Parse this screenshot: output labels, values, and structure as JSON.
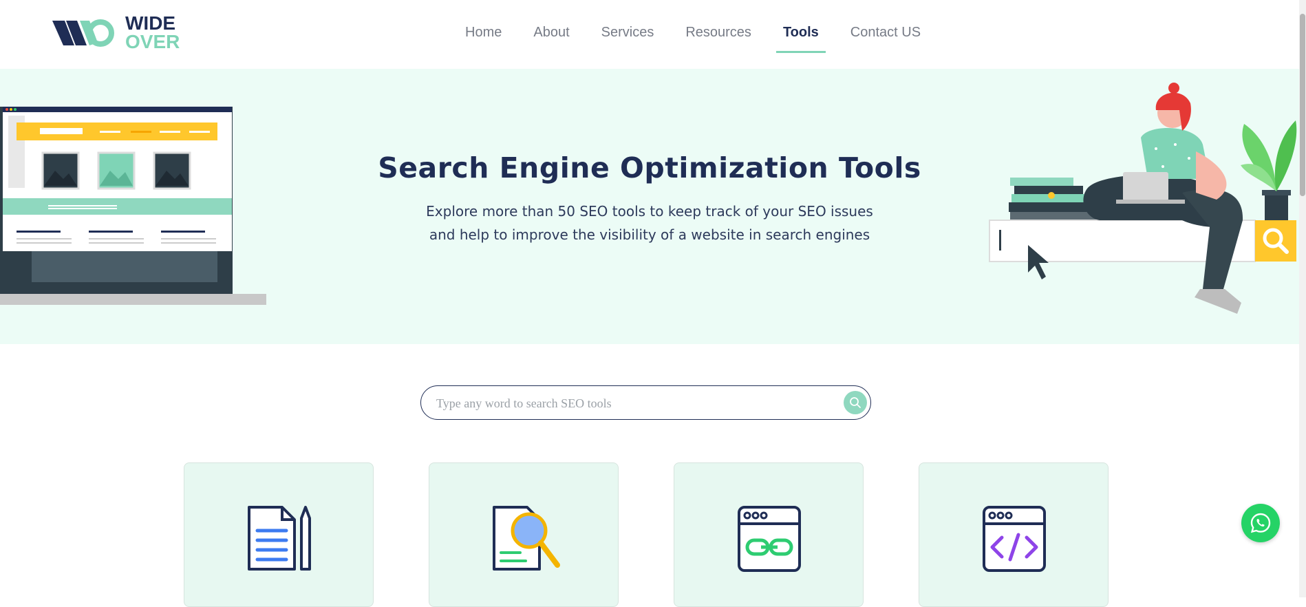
{
  "brand": {
    "line1": "WIDE",
    "line2": "OVER",
    "colors": {
      "navy": "#1f2d55",
      "mint": "#7fd4b6"
    }
  },
  "nav": {
    "items": [
      {
        "label": "Home"
      },
      {
        "label": "About"
      },
      {
        "label": "Services"
      },
      {
        "label": "Resources"
      },
      {
        "label": "Tools",
        "active": true
      },
      {
        "label": "Contact US"
      }
    ]
  },
  "hero": {
    "title": "Search Engine Optimization Tools",
    "subtitle_line1": "Explore more than 50 SEO tools to keep track of your SEO issues",
    "subtitle_line2": "and help to improve the visibility of a website in search engines"
  },
  "search": {
    "placeholder": "Type any word to search SEO tools",
    "value": ""
  },
  "cards": [
    {
      "icon": "document-pencil-icon"
    },
    {
      "icon": "document-search-icon"
    },
    {
      "icon": "browser-link-icon"
    },
    {
      "icon": "browser-code-icon"
    }
  ],
  "floating": {
    "icon": "whatsapp-icon"
  }
}
